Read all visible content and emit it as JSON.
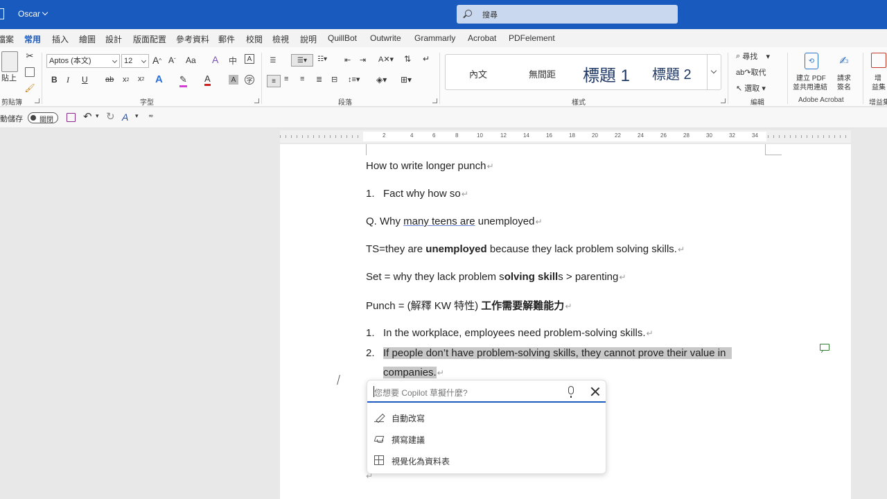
{
  "titlebar": {
    "user": "Oscar",
    "search_placeholder": "搜尋"
  },
  "tabs": [
    "檔案",
    "常用",
    "插入",
    "繪圖",
    "設計",
    "版面配置",
    "參考資料",
    "郵件",
    "校閱",
    "檢視",
    "說明",
    "QuillBot",
    "Outwrite",
    "Grammarly",
    "Acrobat",
    "PDFelement"
  ],
  "active_tab": "常用",
  "ribbon": {
    "clipboard": {
      "paste": "貼上",
      "label": "剪貼簿"
    },
    "font": {
      "name": "Aptos (本文)",
      "size": "12",
      "label": "字型"
    },
    "paragraph": {
      "label": "段落"
    },
    "styles": {
      "items": [
        "內文",
        "無間距",
        "標題 1",
        "標題 2"
      ],
      "label": "樣式"
    },
    "editing": {
      "find": "尋找",
      "replace": "取代",
      "select": "選取",
      "label": "編輯"
    },
    "acrobat": {
      "create_pdf": "建立 PDF",
      "create_pdf_2": "並共用連結",
      "request_sign": "請求",
      "request_sign_2": "簽名",
      "label": "Adobe Acrobat"
    },
    "addins": {
      "label": "增",
      "label2": "益集",
      "group": "增益集"
    }
  },
  "qat": {
    "autosave": "動儲存",
    "toggle": "關閉"
  },
  "ruler": [
    "2",
    "2",
    "4",
    "6",
    "8",
    "10",
    "12",
    "14",
    "16",
    "18",
    "20",
    "22",
    "24",
    "26",
    "28",
    "30",
    "32",
    "34"
  ],
  "document": {
    "heading": "How to write longer punch",
    "item1_num": "1.",
    "item1": "Fact why how so",
    "q_pre": "Q. Why ",
    "q_underlined": "many teens are",
    "q_post": " unemployed",
    "ts_pre": "TS=they are ",
    "ts_bold": "unemployed",
    "ts_post": " because they lack problem solving skills.",
    "set_pre": "Set = why they lack problem s",
    "set_bold": "olving skill",
    "set_post": "s > parenting",
    "punch_pre": "Punch = (解釋 KW 特性)  ",
    "punch_bold": "工作需要解難能力",
    "list2_1_num": "1.",
    "list2_1": "In the workplace, employees need problem-solving skills.",
    "list2_2_num": "2.",
    "list2_2a": "If people don’t have problem-solving skills, they cannot prove their value in",
    "list2_2b": "companies."
  },
  "copilot": {
    "placeholder": "您想要 Copilot 草擬什麼?",
    "items": [
      "自動改寫",
      "撰寫建議",
      "視覺化為資料表"
    ]
  },
  "symbols": {
    "para_mark": "↵"
  }
}
